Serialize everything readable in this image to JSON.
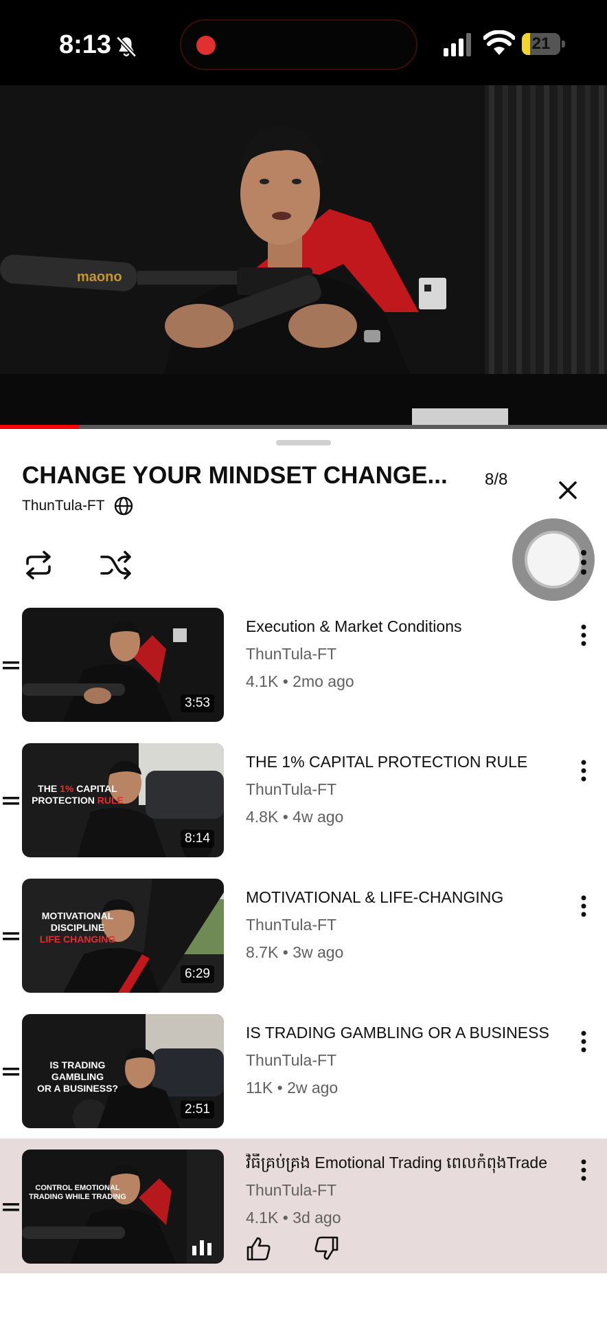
{
  "status_bar": {
    "time": "8:13",
    "battery_level": "21",
    "battery_fraction": 0.21,
    "icons": [
      "bell-slash-icon",
      "recording-dot-icon",
      "signal-icon",
      "wifi-icon",
      "battery-icon"
    ],
    "recording_color": "#e0302f",
    "battery_color": "#f1d632"
  },
  "video": {
    "mic_brand": "maono",
    "progress_fraction": 0.13,
    "progress_color": "#ff0000"
  },
  "playlist": {
    "title": "CHANGE YOUR MINDSET CHANGE...",
    "position": "8/8",
    "channel": "ThunTula-FT",
    "icons": [
      "globe-icon",
      "close-icon",
      "loop-icon",
      "shuffle-icon",
      "more-vertical-icon"
    ]
  },
  "videos": [
    {
      "title": "Execution & Market Conditions",
      "channel": "ThunTula-FT",
      "views": "4.1K",
      "age": "2mo ago",
      "duration": "3:53"
    },
    {
      "title": "THE 1% CAPITAL PROTECTION RULE",
      "channel": "ThunTula-FT",
      "views": "4.8K",
      "age": "4w ago",
      "duration": "8:14",
      "caption_1": "THE",
      "caption_red": "1%",
      "caption_2": "CAPITAL",
      "caption_3": "PROTECTION",
      "caption_red_2": "RULE"
    },
    {
      "title": "MOTIVATIONAL & LIFE-CHANGING",
      "channel": "ThunTula-FT",
      "views": "8.7K",
      "age": "3w ago",
      "duration": "6:29",
      "caption_1": "MOTIVATIONAL",
      "caption_2": "DISCIPLINE",
      "caption_red": "LIFE CHANGING"
    },
    {
      "title": "IS TRADING GAMBLING OR A BUSINESS",
      "channel": "ThunTula-FT",
      "views": "11K",
      "age": "2w ago",
      "duration": "2:51",
      "caption_1": "IS TRADING GAMBLING",
      "caption_2": "OR A BUSINESS?"
    },
    {
      "title": "វិធីគ្រប់គ្រង Emotional Trading ពេលកំពុងTrade",
      "channel": "ThunTula-FT",
      "views": "4.1K",
      "age": "3d ago",
      "caption_1": "CONTROL EMOTIONAL",
      "caption_2": "TRADING WHILE TRADING",
      "now_playing": true
    }
  ],
  "meta_separator": "•",
  "colors": {
    "active_row": "#e7dcdb",
    "secondary_text": "#606060",
    "accent_red": "#e0302f"
  }
}
